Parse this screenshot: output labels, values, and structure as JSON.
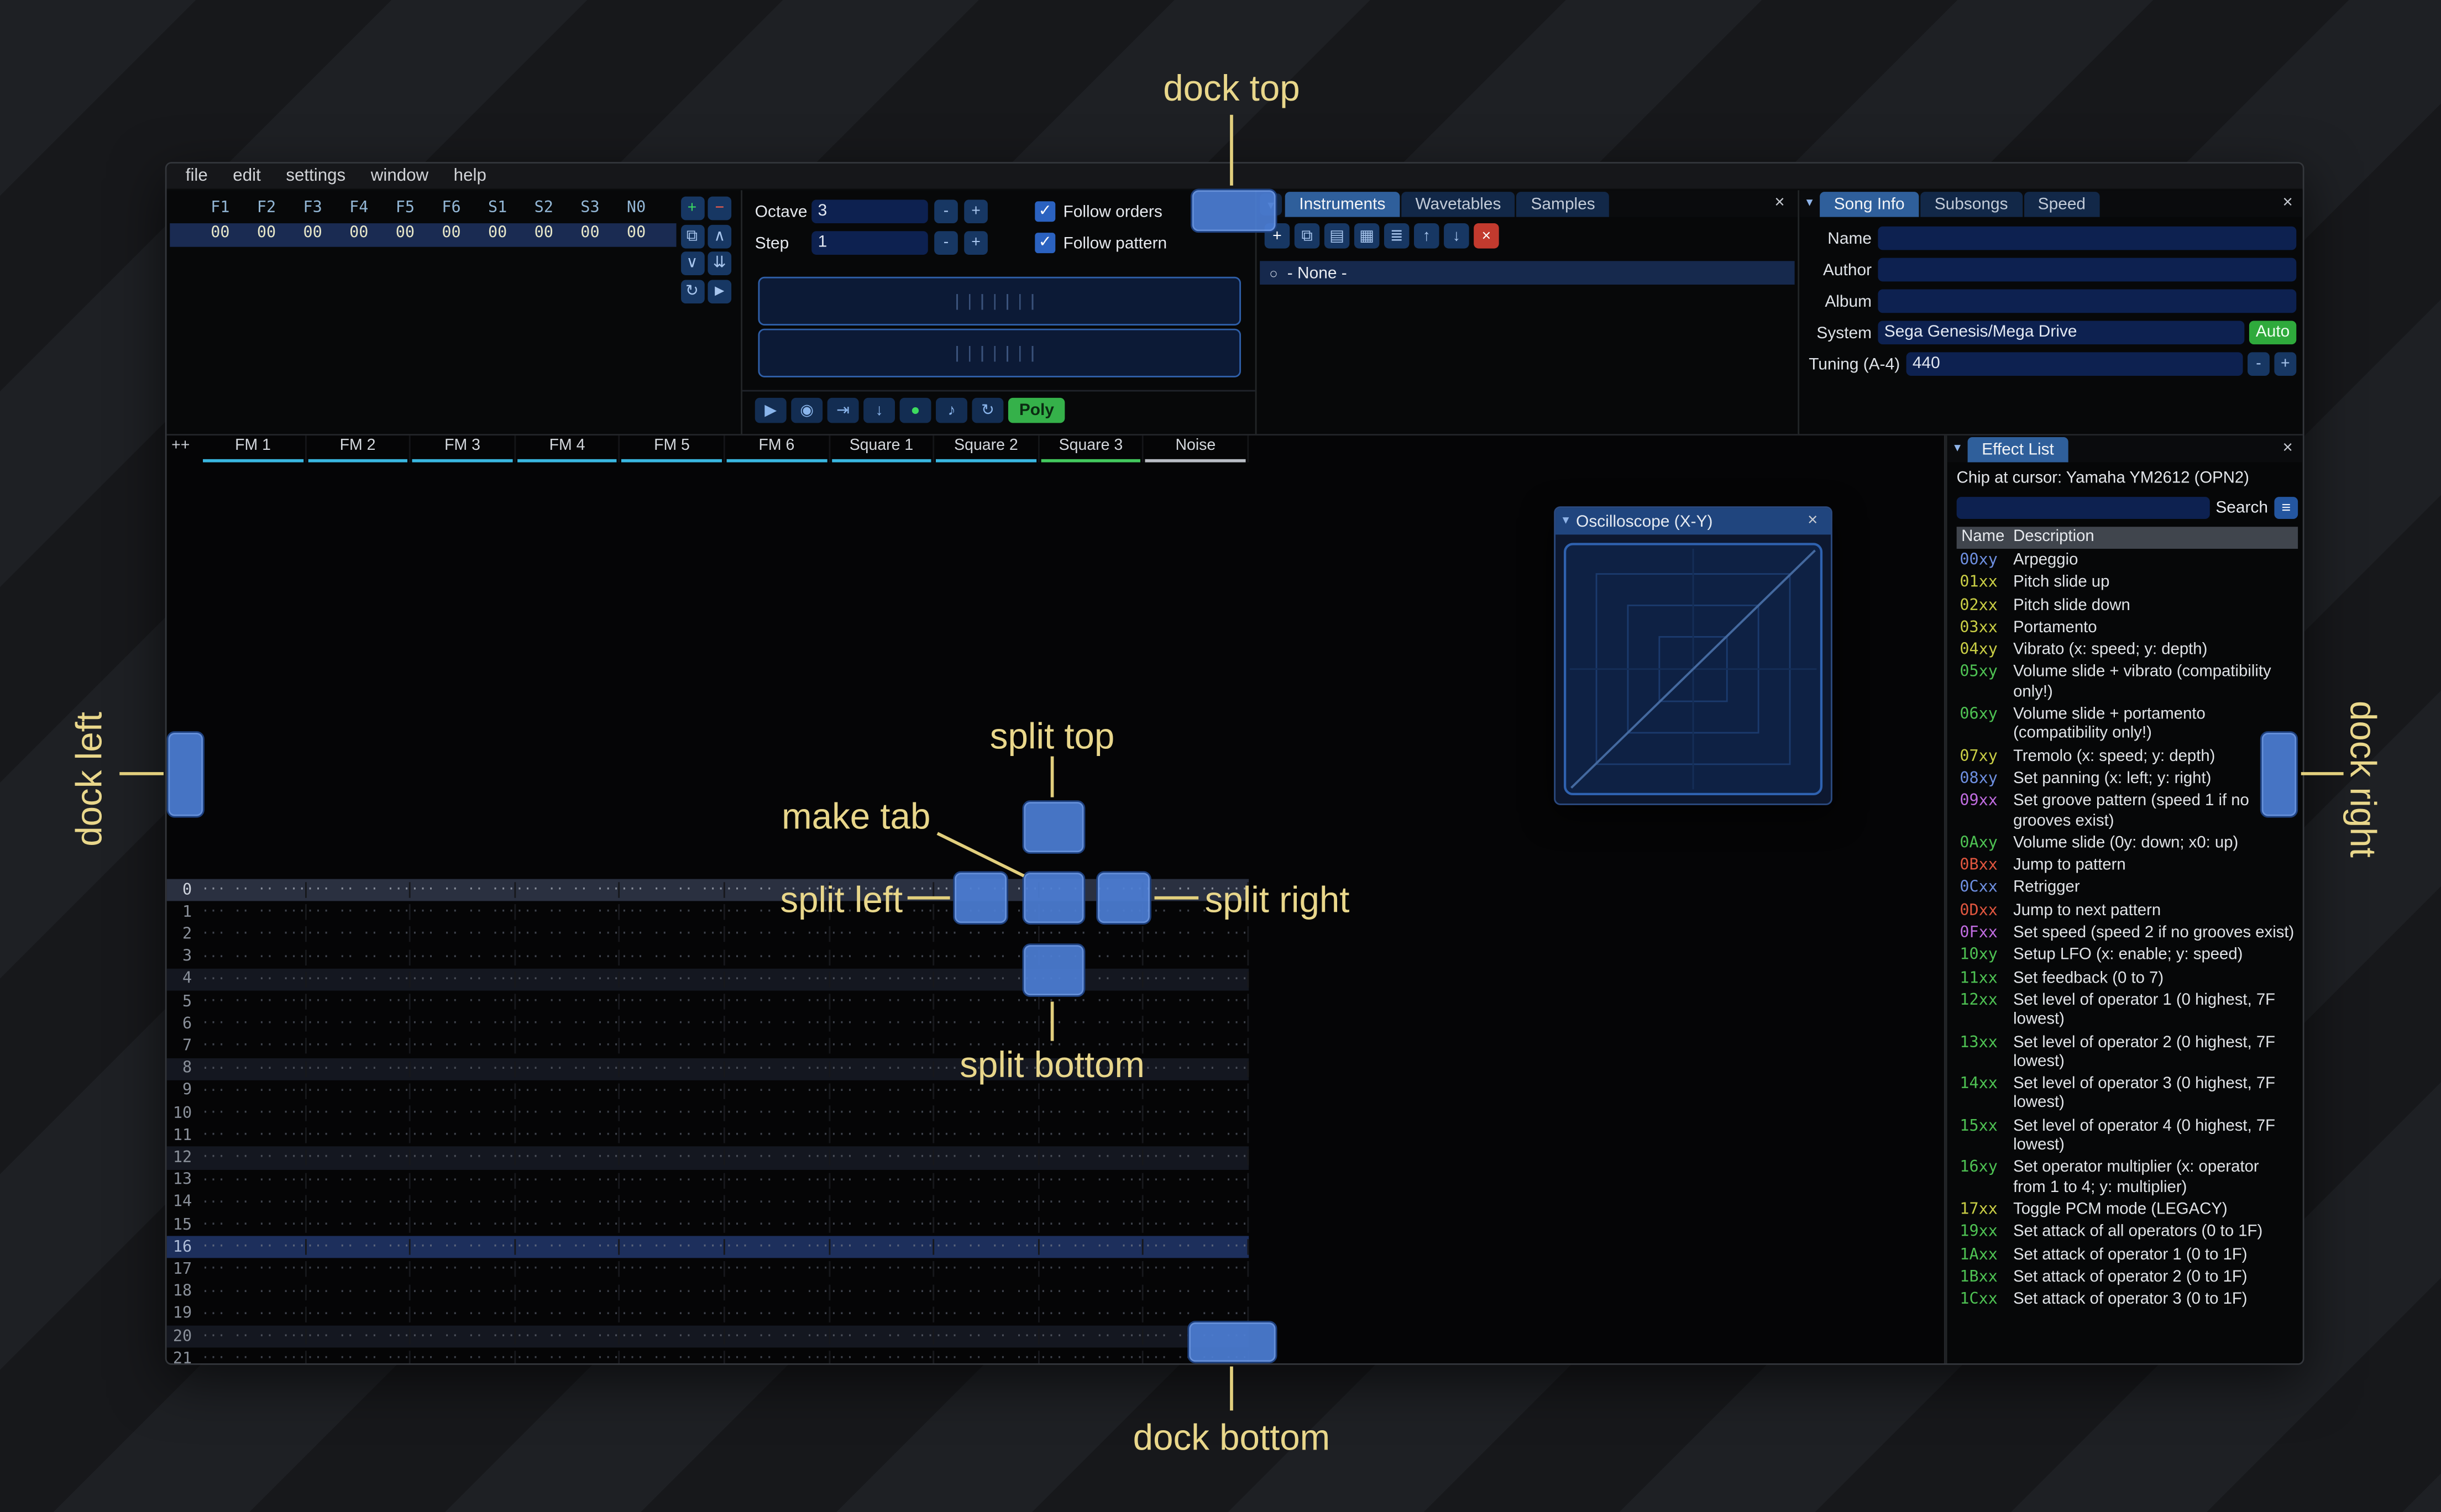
{
  "icons": {
    "close": "×",
    "collapse": "▼",
    "dropdown": "▾",
    "radio": "○",
    "hamburger": "≡",
    "check": "✓"
  },
  "menu": {
    "items": [
      "file",
      "edit",
      "settings",
      "window",
      "help"
    ]
  },
  "orders": {
    "columns": [
      "F1",
      "F2",
      "F3",
      "F4",
      "F5",
      "F6",
      "S1",
      "S2",
      "S3",
      "N0"
    ],
    "row_values": [
      "00",
      "00",
      "00",
      "00",
      "00",
      "00",
      "00",
      "00",
      "00",
      "00"
    ],
    "buttons": [
      {
        "name": "add-order-button",
        "glyph": "+",
        "color": "#3bdc62"
      },
      {
        "name": "remove-order-button",
        "glyph": "−",
        "color": "#ff5f4a"
      },
      {
        "name": "duplicate-order-button",
        "glyph": "⧉",
        "color": "#a8c6ee"
      },
      {
        "name": "move-order-up-button",
        "glyph": "∧",
        "color": "#a8c6ee"
      },
      {
        "name": "move-order-down-button",
        "glyph": "∨",
        "color": "#a8c6ee"
      },
      {
        "name": "order-double-down-button",
        "glyph": "⇊",
        "color": "#a8c6ee"
      },
      {
        "name": "order-loop-button",
        "glyph": "↻",
        "color": "#a8c6ee"
      },
      {
        "name": "order-edit-mode-button",
        "glyph": "►",
        "color": "#a8c6ee"
      }
    ]
  },
  "controls": {
    "octave_label": "Octave",
    "octave_value": "3",
    "step_label": "Step",
    "step_value": "1",
    "minus": "-",
    "plus": "+",
    "follow_orders": "Follow orders",
    "follow_pattern": "Follow pattern",
    "transport": [
      {
        "name": "play-button",
        "glyph": "▶"
      },
      {
        "name": "play-pattern-button",
        "glyph": "◉"
      },
      {
        "name": "step-one-row-button",
        "glyph": "⇥"
      },
      {
        "name": "move-cursor-down-button",
        "glyph": "↓"
      },
      {
        "name": "record-button",
        "glyph": "●",
        "color": "#3ddc5f"
      },
      {
        "name": "metronome-button",
        "glyph": "♪"
      },
      {
        "name": "repeat-pattern-button",
        "glyph": "↻"
      }
    ],
    "poly_label": "Poly"
  },
  "instruments": {
    "tabs": [
      "Instruments",
      "Wavetables",
      "Samples"
    ],
    "active_tab": "Instruments",
    "toolbar": [
      {
        "name": "add-instrument-button",
        "glyph": "+",
        "color": "#ffffff"
      },
      {
        "name": "duplicate-instrument-button",
        "glyph": "⧉"
      },
      {
        "name": "open-instrument-button",
        "glyph": "▤"
      },
      {
        "name": "save-instrument-button",
        "glyph": "▦"
      },
      {
        "name": "instrument-organize-button",
        "glyph": "≣"
      },
      {
        "name": "move-instrument-up-button",
        "glyph": "↑"
      },
      {
        "name": "move-instrument-down-button",
        "glyph": "↓"
      },
      {
        "name": "delete-instrument-button",
        "glyph": "×",
        "color": "#ffffff",
        "bg": "#c23a2e"
      }
    ],
    "items": [
      {
        "label": "- None -"
      }
    ]
  },
  "song_info": {
    "tabs": [
      "Song Info",
      "Subsongs",
      "Speed"
    ],
    "active_tab": "Song Info",
    "fields": [
      {
        "label": "Name",
        "value": ""
      },
      {
        "label": "Author",
        "value": ""
      },
      {
        "label": "Album",
        "value": ""
      },
      {
        "label": "System",
        "value": "Sega Genesis/Mega Drive",
        "button": "Auto"
      },
      {
        "label": "Tuning (A-4)",
        "value": "440",
        "steppers": true
      }
    ],
    "auto_color": "#2faa3c"
  },
  "pattern": {
    "corner": "++",
    "channels": [
      {
        "name": "FM 1",
        "color": "#39b7e0"
      },
      {
        "name": "FM 2",
        "color": "#39b7e0"
      },
      {
        "name": "FM 3",
        "color": "#39b7e0"
      },
      {
        "name": "FM 4",
        "color": "#39b7e0"
      },
      {
        "name": "FM 5",
        "color": "#39b7e0"
      },
      {
        "name": "FM 6",
        "color": "#39b7e0"
      },
      {
        "name": "Square 1",
        "color": "#39b7e0"
      },
      {
        "name": "Square 2",
        "color": "#39b7e0"
      },
      {
        "name": "Square 3",
        "color": "#43c95d"
      },
      {
        "name": "Noise",
        "color": "#b9bdc4"
      }
    ],
    "visible_rows": 22,
    "current_row": 0,
    "highlight_minor": 4,
    "highlight_major": 16,
    "empty_cell": "··· ·· ·· ···"
  },
  "oscilloscope": {
    "title": "Oscilloscope (X-Y)"
  },
  "effect_list": {
    "tab": "Effect List",
    "chip_line": "Chip at cursor: Yamaha YM2612 (OPN2)",
    "search_label": "Search",
    "header": {
      "name": "Name",
      "description": "Description"
    },
    "effects": [
      {
        "code": "00xy",
        "color": "#6e8fe0",
        "desc": "Arpeggio"
      },
      {
        "code": "01xx",
        "color": "#c9ce45",
        "desc": "Pitch slide up"
      },
      {
        "code": "02xx",
        "color": "#c9ce45",
        "desc": "Pitch slide down"
      },
      {
        "code": "03xx",
        "color": "#c9ce45",
        "desc": "Portamento"
      },
      {
        "code": "04xy",
        "color": "#c9ce45",
        "desc": "Vibrato (x: speed; y: depth)"
      },
      {
        "code": "05xy",
        "color": "#4ec253",
        "desc": "Volume slide + vibrato (compatibility only!)"
      },
      {
        "code": "06xy",
        "color": "#4ec253",
        "desc": "Volume slide + portamento (compatibility only!)"
      },
      {
        "code": "07xy",
        "color": "#c9ce45",
        "desc": "Tremolo (x: speed; y: depth)"
      },
      {
        "code": "08xy",
        "color": "#6e8fe0",
        "desc": "Set panning (x: left; y: right)"
      },
      {
        "code": "09xx",
        "color": "#c06ce0",
        "desc": "Set groove pattern (speed 1 if no grooves exist)"
      },
      {
        "code": "0Axy",
        "color": "#4ec253",
        "desc": "Volume slide (0y: down; x0: up)"
      },
      {
        "code": "0Bxx",
        "color": "#e0563f",
        "desc": "Jump to pattern"
      },
      {
        "code": "0Cxx",
        "color": "#6e8fe0",
        "desc": "Retrigger"
      },
      {
        "code": "0Dxx",
        "color": "#e0563f",
        "desc": "Jump to next pattern"
      },
      {
        "code": "0Fxx",
        "color": "#c06ce0",
        "desc": "Set speed (speed 2 if no grooves exist)"
      },
      {
        "code": "10xy",
        "color": "#4ec253",
        "desc": "Setup LFO (x: enable; y: speed)"
      },
      {
        "code": "11xx",
        "color": "#4ec253",
        "desc": "Set feedback (0 to 7)"
      },
      {
        "code": "12xx",
        "color": "#4ec253",
        "desc": "Set level of operator 1 (0 highest, 7F lowest)"
      },
      {
        "code": "13xx",
        "color": "#4ec253",
        "desc": "Set level of operator 2 (0 highest, 7F lowest)"
      },
      {
        "code": "14xx",
        "color": "#4ec253",
        "desc": "Set level of operator 3 (0 highest, 7F lowest)"
      },
      {
        "code": "15xx",
        "color": "#4ec253",
        "desc": "Set level of operator 4 (0 highest, 7F lowest)"
      },
      {
        "code": "16xy",
        "color": "#4ec253",
        "desc": "Set operator multiplier (x: operator from 1 to 4; y: multiplier)"
      },
      {
        "code": "17xx",
        "color": "#c9ce45",
        "desc": "Toggle PCM mode (LEGACY)"
      },
      {
        "code": "19xx",
        "color": "#4ec253",
        "desc": "Set attack of all operators (0 to 1F)"
      },
      {
        "code": "1Axx",
        "color": "#4ec253",
        "desc": "Set attack of operator 1 (0 to 1F)"
      },
      {
        "code": "1Bxx",
        "color": "#4ec253",
        "desc": "Set attack of operator 2 (0 to 1F)"
      },
      {
        "code": "1Cxx",
        "color": "#4ec253",
        "desc": "Set attack of operator 3 (0 to 1F)"
      }
    ]
  },
  "overlay": {
    "accent_color": "#4c7ed5",
    "label_color": "#e9d78b",
    "labels": {
      "dock_top": "dock top",
      "dock_left": "dock left",
      "dock_right": "dock right",
      "dock_bottom": "dock bottom",
      "split_top": "split top",
      "split_left": "split left",
      "split_right": "split right",
      "split_bottom": "split bottom",
      "make_tab": "make tab"
    }
  }
}
